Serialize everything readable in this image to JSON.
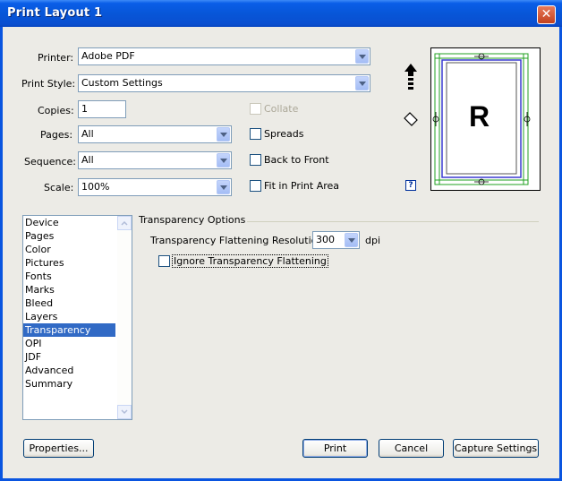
{
  "window": {
    "title": "Print Layout 1",
    "close_glyph": "✕"
  },
  "form": {
    "printer_label": "Printer:",
    "printer_value": "Adobe PDF",
    "print_style_label": "Print Style:",
    "print_style_value": "Custom Settings",
    "copies_label": "Copies:",
    "copies_value": "1",
    "pages_label": "Pages:",
    "pages_value": "All",
    "sequence_label": "Sequence:",
    "sequence_value": "All",
    "scale_label": "Scale:",
    "scale_value": "100%",
    "collate_label": "Collate",
    "collate_checked": false,
    "spreads_label": "Spreads",
    "back_to_front_label": "Back to Front",
    "fit_in_print_area_label": "Fit in Print Area"
  },
  "preview": {
    "letter": "R",
    "help_glyph": "?"
  },
  "categories": {
    "items": [
      "Device",
      "Pages",
      "Color",
      "Pictures",
      "Fonts",
      "Marks",
      "Bleed",
      "Layers",
      "Transparency",
      "OPI",
      "JDF",
      "Advanced",
      "Summary"
    ],
    "selected": "Transparency"
  },
  "transparency": {
    "group_title": "Transparency Options",
    "resolution_label": "Transparency Flattening Resolution:",
    "resolution_value": "300",
    "resolution_unit": "dpi",
    "ignore_label": "Ignore Transparency Flattening",
    "ignore_checked": false
  },
  "buttons": {
    "properties": "Properties...",
    "print": "Print",
    "cancel": "Cancel",
    "capture_settings": "Capture Settings"
  }
}
